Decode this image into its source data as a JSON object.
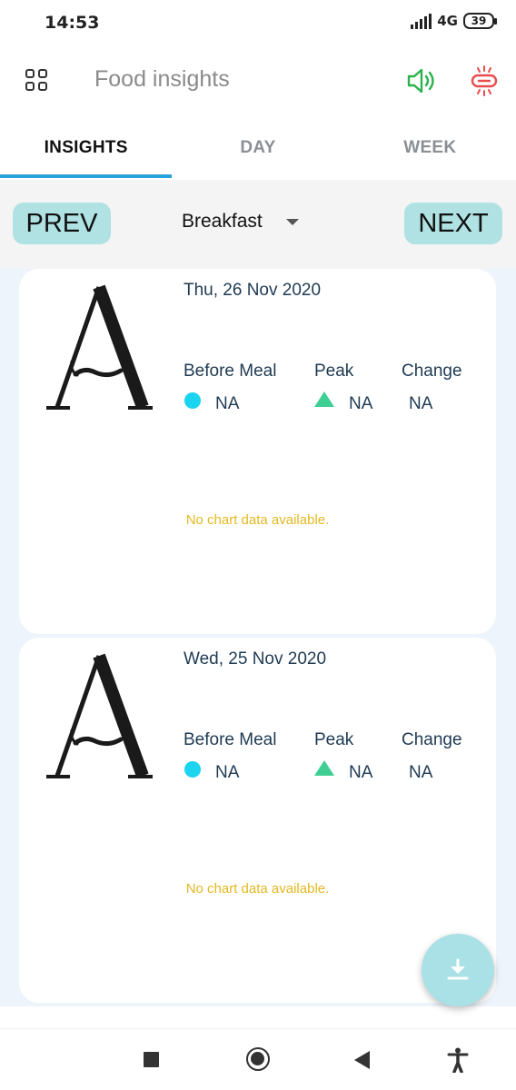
{
  "status_bar": {
    "time": "14:53",
    "network": "4G",
    "battery": "39"
  },
  "app_bar": {
    "title": "Food insights",
    "icons": [
      "grid-menu-icon",
      "speaker-icon",
      "link-icon"
    ],
    "accent_green": "#2bb24c",
    "accent_red": "#e84c4c"
  },
  "tabs": [
    {
      "label": "INSIGHTS",
      "active": true
    },
    {
      "label": "DAY",
      "active": false
    },
    {
      "label": "WEEK",
      "active": false
    }
  ],
  "selector": {
    "prev_label": "PREV",
    "next_label": "NEXT",
    "meal": "Breakfast"
  },
  "metric_labels": {
    "before": "Before Meal",
    "peak": "Peak",
    "change": "Change"
  },
  "cards": [
    {
      "date": "Thu, 26 Nov 2020",
      "before": "NA",
      "peak": "NA",
      "change": "NA",
      "empty_message": "No chart data available."
    },
    {
      "date": "Wed, 25 Nov 2020",
      "before": "NA",
      "peak": "NA",
      "change": "NA",
      "empty_message": "No chart data available."
    }
  ],
  "colors": {
    "tab_indicator": "#29a3db",
    "button_bg": "#b0e2e3",
    "before_dot": "#1bd4f0",
    "peak_triangle": "#3fcf94",
    "empty_text": "#e3b820",
    "fab_bg": "#a9e1e6"
  },
  "fab": {
    "icon": "download-icon"
  }
}
